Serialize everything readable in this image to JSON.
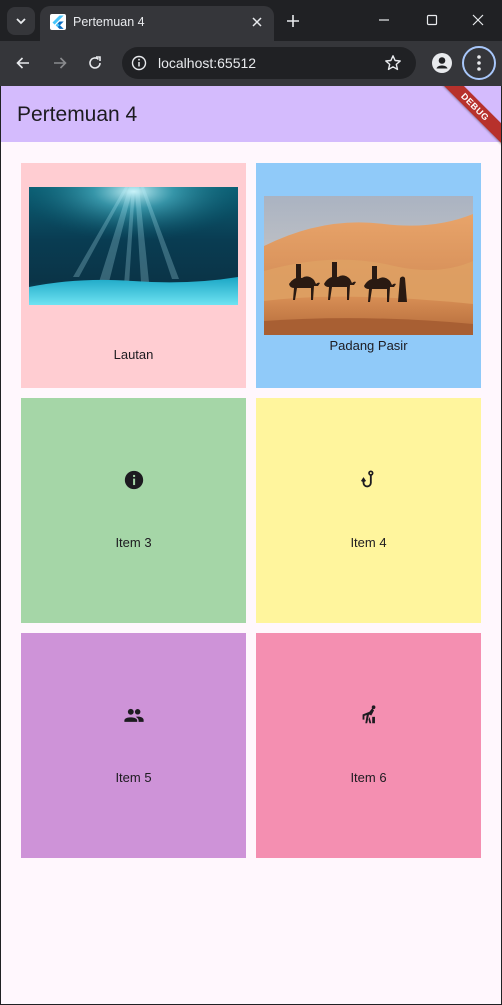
{
  "browser": {
    "tab_title": "Pertemuan 4",
    "url": "localhost:65512"
  },
  "app": {
    "title": "Pertemuan 4",
    "debug_banner": "DEBUG",
    "tiles": [
      {
        "label": "Lautan",
        "color": "#ffcdd2",
        "image": "underwater-photo"
      },
      {
        "label": "Padang Pasir",
        "color": "#90caf9",
        "image": "desert-camels-photo"
      },
      {
        "label": "Item 3",
        "color": "#a5d6a7",
        "icon": "info-icon"
      },
      {
        "label": "Item 4",
        "color": "#fff59d",
        "icon": "phishing-hook-icon"
      },
      {
        "label": "Item 5",
        "color": "#ce93d8",
        "icon": "people-icon"
      },
      {
        "label": "Item 6",
        "color": "#f48fb1",
        "icon": "sports-handball-icon"
      }
    ]
  }
}
